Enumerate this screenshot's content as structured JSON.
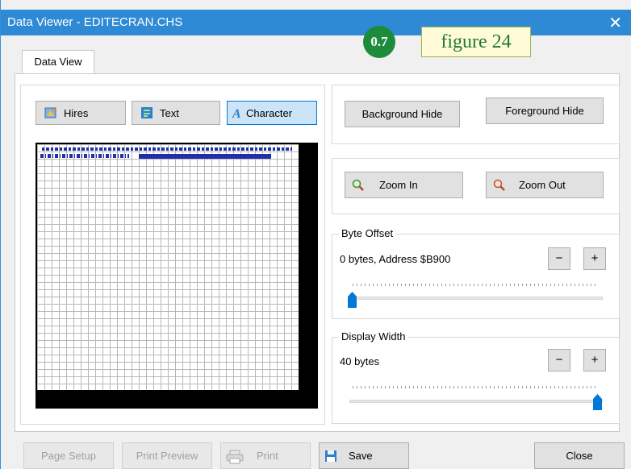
{
  "window": {
    "title": "Data Viewer - EDITECRAN.CHS",
    "close_glyph": "✕"
  },
  "overlay": {
    "badge": "0.7",
    "figure_label": "figure 24"
  },
  "tabs": [
    {
      "label": "Data View",
      "active": true
    }
  ],
  "view_modes": [
    {
      "label": "Hires",
      "icon": "hires-icon",
      "selected": false
    },
    {
      "label": "Text",
      "icon": "text-icon",
      "selected": false
    },
    {
      "label": "Character",
      "icon": "character-icon",
      "selected": true
    }
  ],
  "visibility": {
    "background_hide": "Background Hide",
    "foreground_hide": "Foreground Hide"
  },
  "zoom": {
    "zoom_in": "Zoom In",
    "zoom_out": "Zoom Out"
  },
  "byte_offset": {
    "title": "Byte Offset",
    "value": "0 bytes, Address $B900",
    "minus": "−",
    "plus": "+",
    "slider_position": 0
  },
  "display_width": {
    "title": "Display Width",
    "value": "40 bytes",
    "minus": "−",
    "plus": "+",
    "slider_position": 1
  },
  "bottom": {
    "page_setup": "Page Setup",
    "print_preview": "Print Preview",
    "print": "Print",
    "save": "Save",
    "close": "Close"
  },
  "colors": {
    "accent": "#0078d7",
    "titlebar": "#2f8ad6",
    "char_data": "#1f2fa8"
  }
}
